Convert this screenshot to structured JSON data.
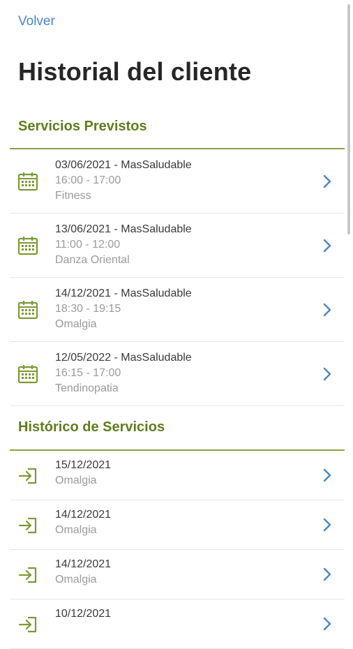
{
  "header": {
    "back_label": "Volver",
    "title": "Historial del cliente"
  },
  "upcoming": {
    "title": "Servicios Previstos",
    "items": [
      {
        "title": "03/06/2021 - MasSaludable",
        "time": "16:00 - 17:00",
        "service": "Fitness"
      },
      {
        "title": "13/06/2021 - MasSaludable",
        "time": "11:00 - 12:00",
        "service": "Danza Oriental"
      },
      {
        "title": "14/12/2021 - MasSaludable",
        "time": "18:30 - 19:15",
        "service": "Omalgia"
      },
      {
        "title": "12/05/2022 - MasSaludable",
        "time": "16:15 - 17:00",
        "service": "Tendinopatia"
      }
    ]
  },
  "history": {
    "title": "Histórico de Servicios",
    "items": [
      {
        "date": "15/12/2021",
        "service": "Omalgia"
      },
      {
        "date": "14/12/2021",
        "service": "Omalgia"
      },
      {
        "date": "14/12/2021",
        "service": "Omalgia"
      },
      {
        "date": "10/12/2021",
        "service": ""
      }
    ]
  },
  "colors": {
    "accent_green": "#5f7d1e",
    "link_blue": "#4a86c8",
    "icon_green": "#7b9a34"
  },
  "icons": {
    "upcoming_item": "calendar-icon",
    "history_item": "sign-in-icon",
    "row_action": "chevron-right-icon"
  }
}
